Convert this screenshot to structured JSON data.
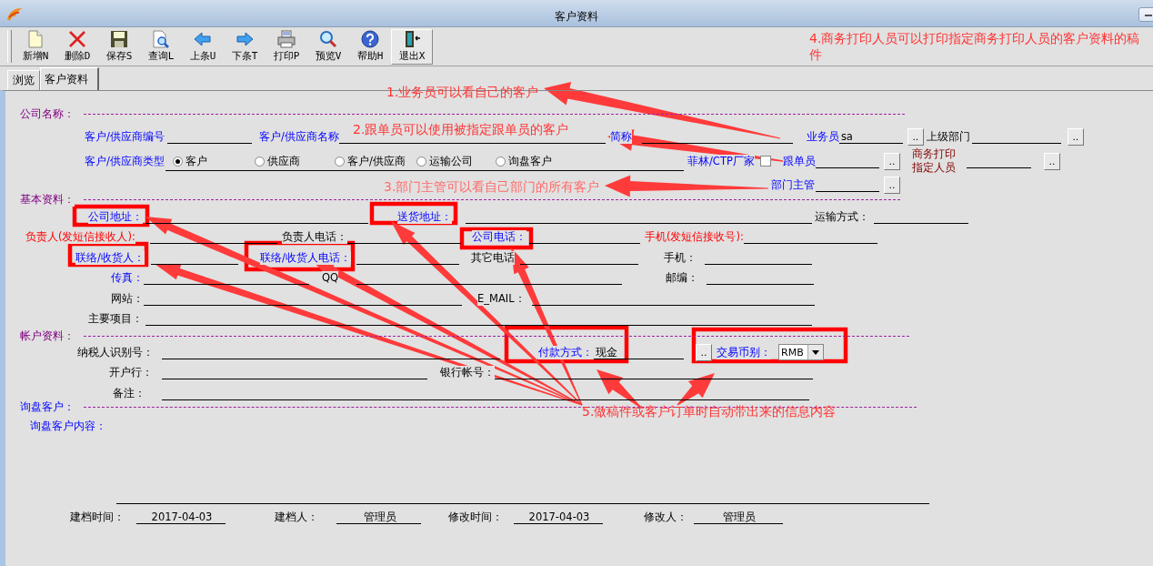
{
  "window": {
    "title": "客户资料"
  },
  "toolbar": [
    {
      "label": "新增N",
      "pressed": false
    },
    {
      "label": "删除D",
      "pressed": false
    },
    {
      "label": "保存S",
      "pressed": false
    },
    {
      "label": "查询L",
      "pressed": false
    },
    {
      "label": "上条U",
      "pressed": false
    },
    {
      "label": "下条T",
      "pressed": false
    },
    {
      "label": "打印P",
      "pressed": false
    },
    {
      "label": "预览V",
      "pressed": false
    },
    {
      "label": "帮助H",
      "pressed": false
    },
    {
      "label": "退出X",
      "pressed": true
    }
  ],
  "tabs": [
    {
      "label": "浏览",
      "selected": false
    },
    {
      "label": "客户资料",
      "selected": true
    }
  ],
  "form": {
    "sections": [
      {
        "title": "公司名称：",
        "kind": "section"
      },
      {
        "title": "基本资料：",
        "kind": "section"
      },
      {
        "title": "帐户资料：",
        "kind": "section"
      },
      {
        "title": "询盘客户：",
        "kind": "key"
      }
    ],
    "fields": [
      {
        "label": "客户/供应商编号",
        "kind": "key"
      },
      {
        "label": "客户/供应商名称",
        "kind": "key"
      },
      {
        "label": "简称",
        "kind": "key"
      },
      {
        "label": "业务员",
        "kind": "key",
        "value": "sa",
        "lookup_button": ".."
      },
      {
        "label": "上级部门",
        "kind": "plain",
        "lookup_button": ".."
      },
      {
        "label": "跟单员",
        "kind": "key",
        "lookup_button": ".."
      },
      {
        "label": "商务打印指定人员",
        "kind": "assigned",
        "lookup_button": ".."
      },
      {
        "label": "部门主管",
        "kind": "key",
        "lookup_button": ".."
      },
      {
        "label": "公司地址：",
        "kind": "key"
      },
      {
        "label": "送货地址：",
        "kind": "key"
      },
      {
        "label": "运输方式：",
        "kind": "plain"
      },
      {
        "label": "负责人(发短信接收人):",
        "kind": "sms"
      },
      {
        "label": "负责人电话：",
        "kind": "plain"
      },
      {
        "label": "公司电话：",
        "kind": "key"
      },
      {
        "label": "手机(发短信接收号):",
        "kind": "sms"
      },
      {
        "label": "联络/收货人：",
        "kind": "key"
      },
      {
        "label": "联络/收货人电话：",
        "kind": "key"
      },
      {
        "label": "其它电话",
        "kind": "plain"
      },
      {
        "label": "手机：",
        "kind": "plain"
      },
      {
        "label": "传真：",
        "kind": "key"
      },
      {
        "label": "QQ",
        "kind": "plain"
      },
      {
        "label": "邮编：",
        "kind": "plain"
      },
      {
        "label": "网站：",
        "kind": "plain"
      },
      {
        "label": "E_MAIL：",
        "kind": "plain"
      },
      {
        "label": "主要项目：",
        "kind": "plain"
      },
      {
        "label": "纳税人识别号：",
        "kind": "plain"
      },
      {
        "label": "付款方式：",
        "kind": "key",
        "value": "现金",
        "lookup_button": ".."
      },
      {
        "label": "开户行：",
        "kind": "plain"
      },
      {
        "label": "银行帐号：",
        "kind": "plain"
      },
      {
        "label": "备注：",
        "kind": "plain"
      }
    ],
    "radio_group": {
      "label": "客户/供应商类型",
      "options": [
        {
          "label": "客户",
          "selected": true
        },
        {
          "label": "供应商",
          "selected": false
        },
        {
          "label": "客户/供应商",
          "selected": false
        },
        {
          "label": "运输公司",
          "selected": false
        },
        {
          "label": "询盘客户",
          "selected": false
        }
      ]
    },
    "checkbox": {
      "label": "菲林/CTP厂家",
      "checked": false
    },
    "currency": {
      "label": "交易币别：",
      "value": "RMB"
    },
    "inquiry_content_label": "询盘客户内容："
  },
  "footer": [
    {
      "label": "建档时间：",
      "value": "2017-04-03"
    },
    {
      "label": "建档人：",
      "value": "管理员"
    },
    {
      "label": "修改时间：",
      "value": "2017-04-03"
    },
    {
      "label": "修改人：",
      "value": "管理员"
    }
  ],
  "annotations": [
    {
      "text": "1.业务员可以看自己的客户"
    },
    {
      "text": "2.跟单员可以使用被指定跟单员的客户"
    },
    {
      "text": "3.部门主管可以看自己部门的所有客户"
    },
    {
      "text": "4.商务打印人员可以打印指定商务打印人员的客户资料的稿件"
    },
    {
      "text": "5.做稿件或客户订单时自动带出来的信息内容"
    }
  ]
}
